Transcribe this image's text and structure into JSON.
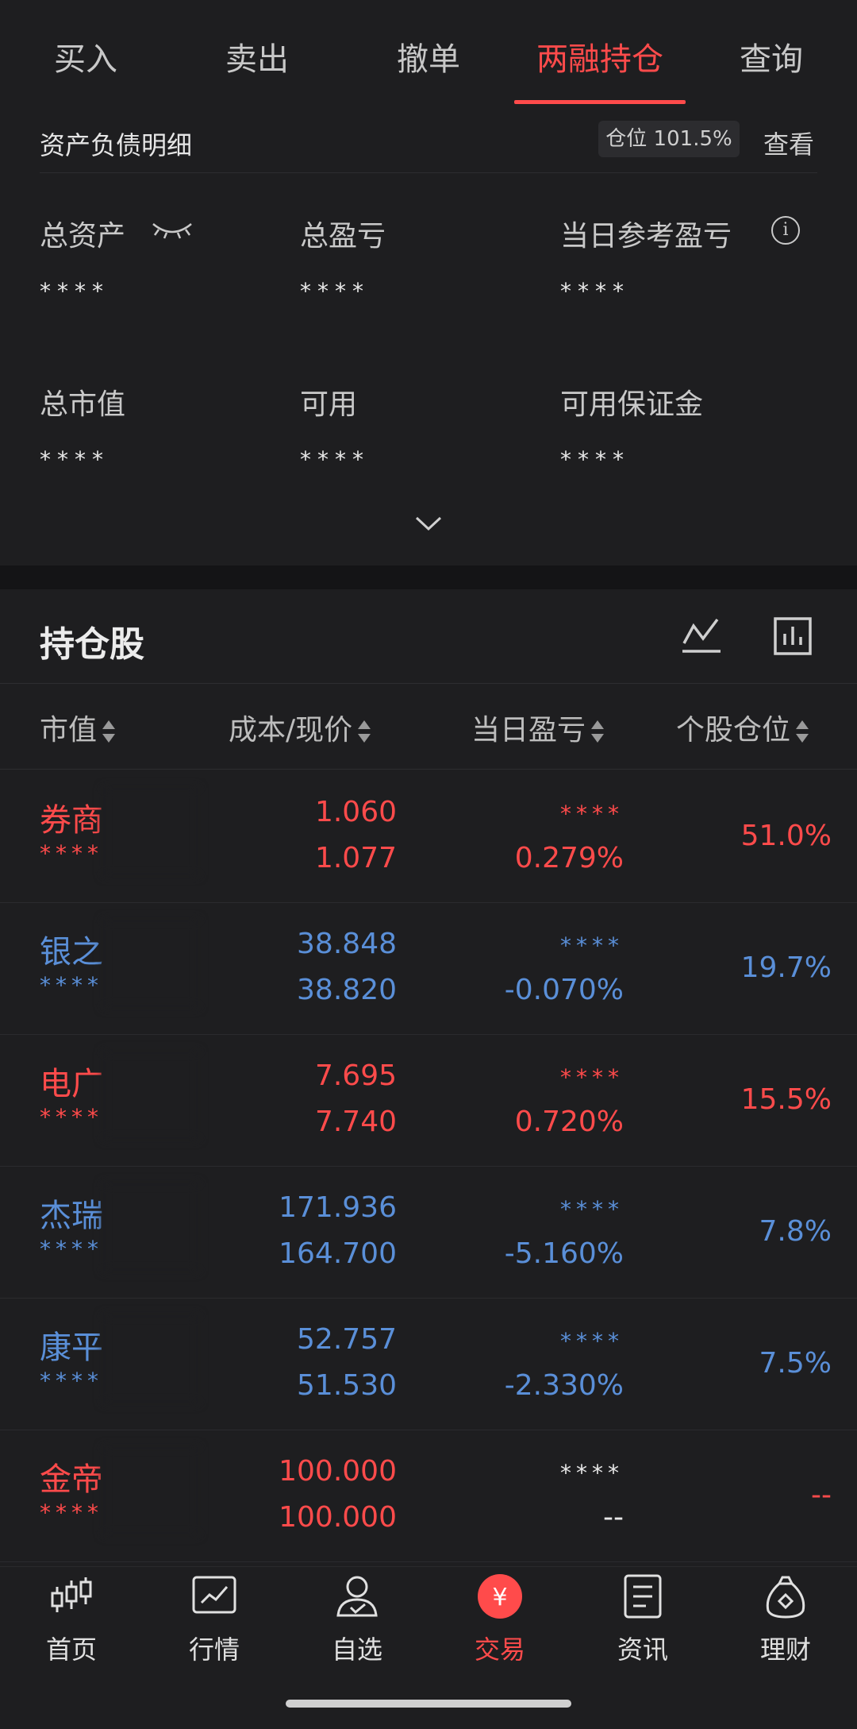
{
  "tabs": [
    "买入",
    "卖出",
    "撤单",
    "两融持仓",
    "查询"
  ],
  "asset_section": {
    "title": "资产负债明细",
    "position_badge": "仓位 101.5%",
    "view_link": "查看",
    "metrics": [
      {
        "label": "总资产",
        "value": "****"
      },
      {
        "label": "总盈亏",
        "value": "****"
      },
      {
        "label": "当日参考盈亏",
        "value": "****"
      },
      {
        "label": "总市值",
        "value": "****"
      },
      {
        "label": "可用",
        "value": "****"
      },
      {
        "label": "可用保证金",
        "value": "****"
      }
    ]
  },
  "holdings": {
    "title": "持仓股",
    "columns": [
      "市值",
      "成本/现价",
      "当日盈亏",
      "个股仓位"
    ],
    "rows": [
      {
        "name": "券商",
        "mask": "****",
        "cost": "1.060",
        "price": "1.077",
        "pnl": "****",
        "pct": "0.279%",
        "weight": "51.0%",
        "color": "#ff4b4b"
      },
      {
        "name": "银之",
        "mask": "****",
        "cost": "38.848",
        "price": "38.820",
        "pnl": "****",
        "pct": "-0.070%",
        "weight": "19.7%",
        "color": "#5a8fd8"
      },
      {
        "name": "电广",
        "mask": "****",
        "cost": "7.695",
        "price": "7.740",
        "pnl": "****",
        "pct": "0.720%",
        "weight": "15.5%",
        "color": "#ff4b4b"
      },
      {
        "name": "杰瑞",
        "mask": "****",
        "cost": "171.936",
        "price": "164.700",
        "pnl": "****",
        "pct": "-5.160%",
        "weight": "7.8%",
        "color": "#5a8fd8"
      },
      {
        "name": "康平",
        "mask": "****",
        "cost": "52.757",
        "price": "51.530",
        "pnl": "****",
        "pct": "-2.330%",
        "weight": "7.5%",
        "color": "#5a8fd8"
      },
      {
        "name": "金帝",
        "mask": "****",
        "cost": "100.000",
        "price": "100.000",
        "pnl": "****",
        "pct": "--",
        "weight": "--",
        "color": "#ff4b4b"
      }
    ]
  },
  "nav": [
    "首页",
    "行情",
    "自选",
    "交易",
    "资讯",
    "理财"
  ],
  "colors": {
    "accent": "#ff4b4b",
    "down": "#5a8fd8"
  }
}
